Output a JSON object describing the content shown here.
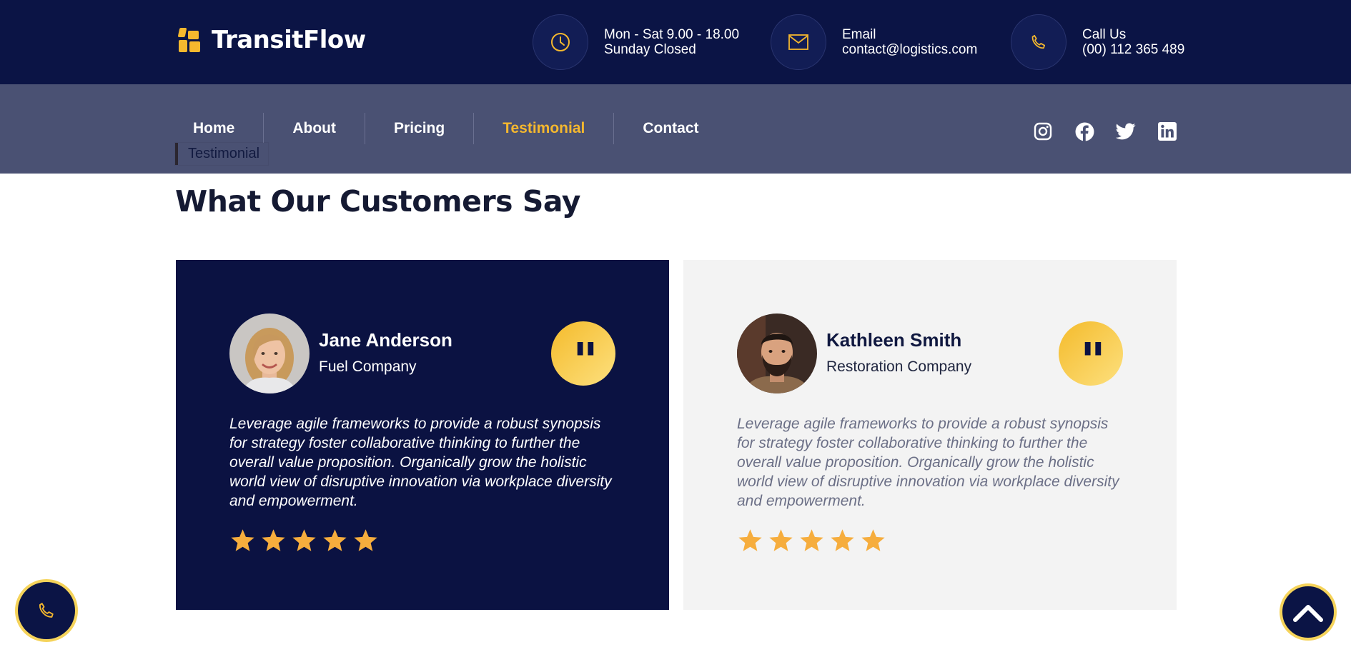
{
  "brand": {
    "name": "TransitFlow",
    "accent": "#f5b82e",
    "navy": "#0b1445"
  },
  "contact_info": [
    {
      "icon": "clock-icon",
      "line1": "Mon - Sat 9.00 - 18.00",
      "line2": "Sunday Closed"
    },
    {
      "icon": "envelope-icon",
      "line1": "Email",
      "line2": "contact@logistics.com"
    },
    {
      "icon": "phone-icon",
      "line1": "Call Us",
      "line2": "(00) 112 365 489"
    }
  ],
  "nav": {
    "items": [
      "Home",
      "About",
      "Pricing",
      "Testimonial",
      "Contact"
    ],
    "active": "Testimonial",
    "tooltip": "Testimonial"
  },
  "socials": [
    "instagram-icon",
    "facebook-icon",
    "twitter-icon",
    "linkedin-icon"
  ],
  "section": {
    "title": "What Our Customers Say"
  },
  "testimonials": [
    {
      "name": "Jane Anderson",
      "company": "Fuel Company",
      "quote": "Leverage agile frameworks to provide a robust synopsis for strategy foster collaborative thinking to further the overall value proposition. Organically grow the holistic world view of disruptive innovation via workplace diversity and empowerment.",
      "rating": 5,
      "theme": "dark"
    },
    {
      "name": "Kathleen Smith",
      "company": "Restoration Company",
      "quote": "Leverage agile frameworks to provide a robust synopsis for strategy foster collaborative thinking to further the overall value proposition. Organically grow the holistic world view of disruptive innovation via workplace diversity and empowerment.",
      "rating": 5,
      "theme": "light"
    }
  ],
  "floating": {
    "call_icon": "phone-icon",
    "scroll_icon": "chevron-up-icon"
  }
}
